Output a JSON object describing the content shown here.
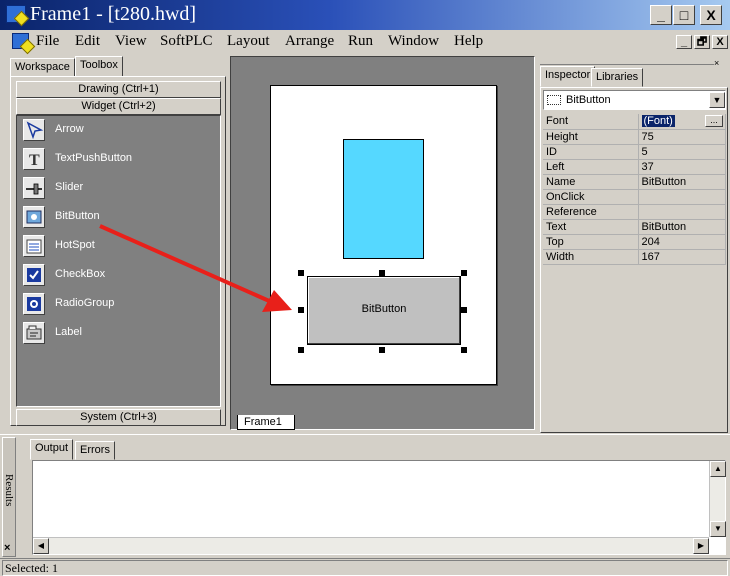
{
  "window": {
    "title": "Frame1 - [t280.hwd]"
  },
  "caption_buttons": [
    "_",
    "□",
    "X"
  ],
  "menus": [
    "File",
    "Edit",
    "View",
    "SoftPLC",
    "Layout",
    "Arrange",
    "Run",
    "Window",
    "Help"
  ],
  "mdi_buttons": [
    "_",
    "🗗",
    "X"
  ],
  "left_panel": {
    "tabs": [
      "Workspace",
      "Toolbox"
    ],
    "active_tab": "Toolbox",
    "sections": {
      "drawing": "Drawing (Ctrl+1)",
      "widget": "Widget (Ctrl+2)",
      "system": "System (Ctrl+3)"
    },
    "tools": [
      {
        "label": "Arrow",
        "icon": "arrow-icon"
      },
      {
        "label": "TextPushButton",
        "icon": "text-push-button-icon"
      },
      {
        "label": "Slider",
        "icon": "slider-icon"
      },
      {
        "label": "BitButton",
        "icon": "bit-button-icon"
      },
      {
        "label": "HotSpot",
        "icon": "hotspot-icon"
      },
      {
        "label": "CheckBox",
        "icon": "checkbox-icon"
      },
      {
        "label": "RadioGroup",
        "icon": "radio-group-icon"
      },
      {
        "label": "Label",
        "icon": "label-icon"
      }
    ]
  },
  "canvas": {
    "tab": "Frame1",
    "widget_label": "BitButton",
    "cyan_color": "#55d8ff",
    "arrow_color": "#e8201a"
  },
  "inspector": {
    "tabs": [
      "Inspector",
      "Libraries"
    ],
    "active_tab": "Inspector",
    "selected_object": "BitButton",
    "properties": [
      {
        "name": "Font",
        "value": "(Font)"
      },
      {
        "name": "Height",
        "value": "75"
      },
      {
        "name": "ID",
        "value": "5"
      },
      {
        "name": "Left",
        "value": "37"
      },
      {
        "name": "Name",
        "value": "BitButton"
      },
      {
        "name": "OnClick",
        "value": ""
      },
      {
        "name": "Reference",
        "value": ""
      },
      {
        "name": "Text",
        "value": "BitButton"
      },
      {
        "name": "Top",
        "value": "204"
      },
      {
        "name": "Width",
        "value": "167"
      }
    ],
    "ellipsis": "..."
  },
  "results": {
    "side_label": "Results",
    "tabs": [
      "Output",
      "Errors"
    ],
    "active_tab": "Output"
  },
  "status": {
    "text": "Selected: 1"
  }
}
